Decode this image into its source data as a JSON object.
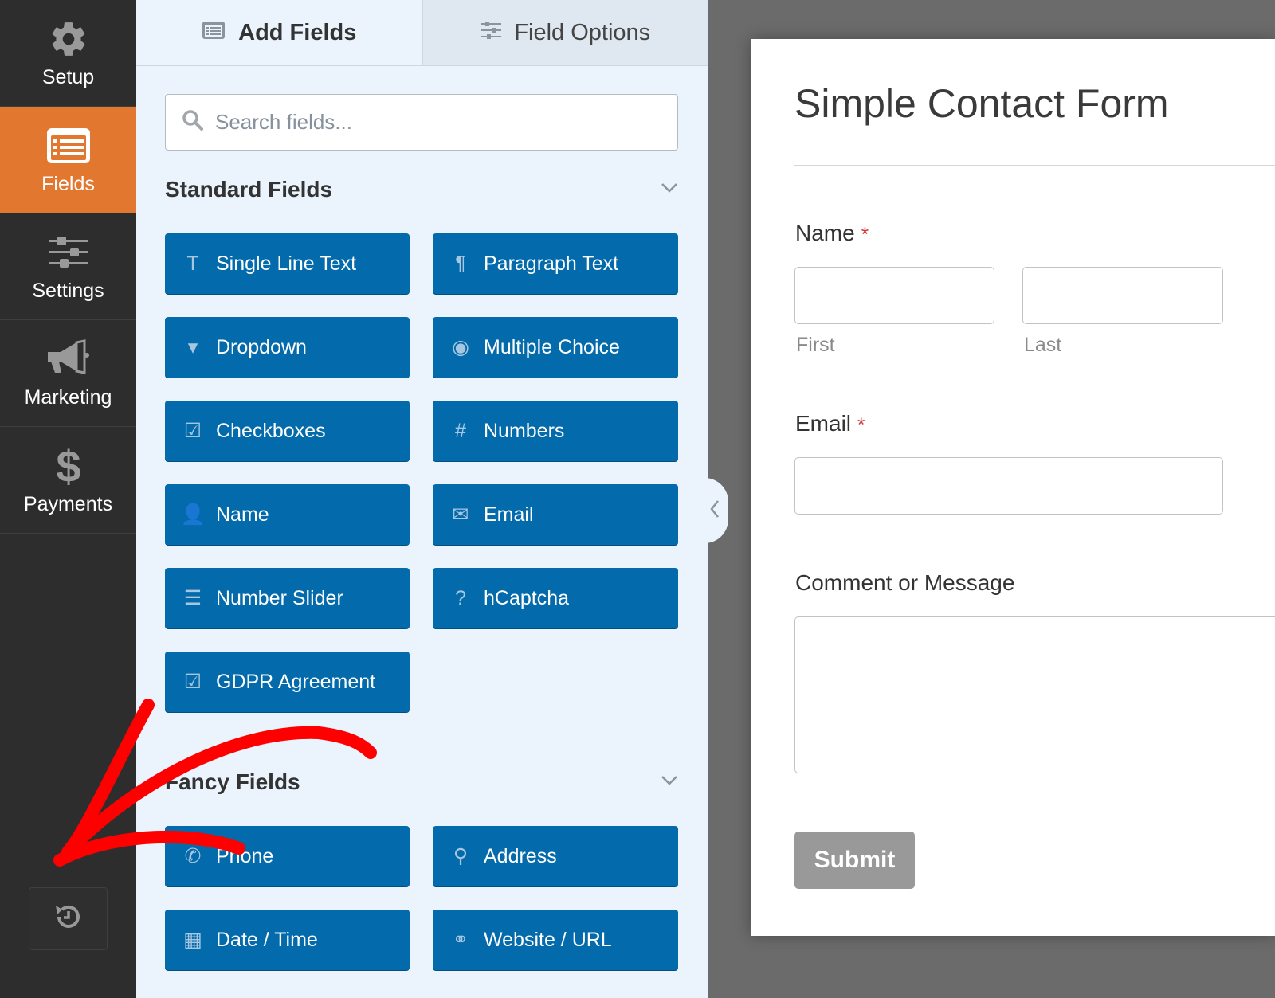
{
  "sidebar": {
    "items": [
      {
        "label": "Setup",
        "icon": "gear-icon",
        "active": false
      },
      {
        "label": "Fields",
        "icon": "fields-list-icon",
        "active": true
      },
      {
        "label": "Settings",
        "icon": "sliders-icon",
        "active": false
      },
      {
        "label": "Marketing",
        "icon": "megaphone-icon",
        "active": false
      },
      {
        "label": "Payments",
        "icon": "dollar-icon",
        "active": false
      }
    ],
    "history_button": {
      "icon": "revision-history-icon"
    }
  },
  "panel": {
    "tabs": [
      {
        "label": "Add Fields",
        "icon": "list-icon",
        "active": true
      },
      {
        "label": "Field Options",
        "icon": "sliders-icon",
        "active": false
      }
    ],
    "search": {
      "placeholder": "Search fields...",
      "value": ""
    },
    "standard_section": {
      "title": "Standard Fields",
      "fields": [
        {
          "label": "Single Line Text",
          "icon": "text-cursor-icon",
          "glyph": "T"
        },
        {
          "label": "Paragraph Text",
          "icon": "paragraph-icon",
          "glyph": "¶"
        },
        {
          "label": "Dropdown",
          "icon": "dropdown-icon",
          "glyph": "▾"
        },
        {
          "label": "Multiple Choice",
          "icon": "radio-icon",
          "glyph": "◉"
        },
        {
          "label": "Checkboxes",
          "icon": "checkbox-icon",
          "glyph": "☑"
        },
        {
          "label": "Numbers",
          "icon": "hash-icon",
          "glyph": "#"
        },
        {
          "label": "Name",
          "icon": "user-icon",
          "glyph": "👤"
        },
        {
          "label": "Email",
          "icon": "envelope-icon",
          "glyph": "✉"
        },
        {
          "label": "Number Slider",
          "icon": "slider-icon",
          "glyph": "☰"
        },
        {
          "label": "hCaptcha",
          "icon": "question-circle-icon",
          "glyph": "?"
        },
        {
          "label": "GDPR Agreement",
          "icon": "checkbox-icon",
          "glyph": "☑"
        }
      ]
    },
    "fancy_section": {
      "title": "Fancy Fields",
      "fields": [
        {
          "label": "Phone",
          "icon": "phone-icon",
          "glyph": "✆"
        },
        {
          "label": "Address",
          "icon": "map-pin-icon",
          "glyph": "⚲"
        },
        {
          "label": "Date / Time",
          "icon": "calendar-icon",
          "glyph": "▦"
        },
        {
          "label": "Website / URL",
          "icon": "link-icon",
          "glyph": "⚭"
        }
      ]
    }
  },
  "preview": {
    "form_title": "Simple Contact Form",
    "fields": {
      "name": {
        "label": "Name",
        "required_mark": "*",
        "first_sublabel": "First",
        "last_sublabel": "Last"
      },
      "email": {
        "label": "Email",
        "required_mark": "*"
      },
      "message": {
        "label": "Comment or Message"
      }
    },
    "submit_label": "Submit"
  },
  "colors": {
    "accent_orange": "#e27730",
    "field_button_blue": "#036aab",
    "sidebar_dark": "#2d2d2d",
    "panel_bg": "#ebf3fc",
    "annotation_red": "#ff0000"
  }
}
